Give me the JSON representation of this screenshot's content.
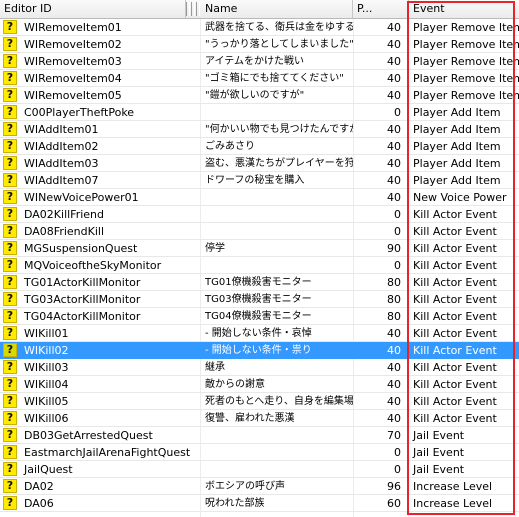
{
  "columns": {
    "editor_id": "Editor ID",
    "name": "Name",
    "priority": "P...",
    "event": "Event"
  },
  "rows": [
    {
      "icon": "?",
      "id": "WIRemoveItem01",
      "name": "武器を捨てる、衛兵は金をゆする",
      "p": "40",
      "event": "Player Remove Item"
    },
    {
      "icon": "?",
      "id": "WIRemoveItem02",
      "name": "\"うっかり落としてしまいました\"",
      "p": "40",
      "event": "Player Remove Item"
    },
    {
      "icon": "?",
      "id": "WIRemoveItem03",
      "name": "アイテムをかけた戦い",
      "p": "40",
      "event": "Player Remove Item"
    },
    {
      "icon": "?",
      "id": "WIRemoveItem04",
      "name": "\"ゴミ箱にでも捨ててください\"",
      "p": "40",
      "event": "Player Remove Item"
    },
    {
      "icon": "?",
      "id": "WIRemoveItem05",
      "name": "\"鎧が欲しいのですが\"",
      "p": "40",
      "event": "Player Remove Item"
    },
    {
      "icon": "?",
      "id": "C00PlayerTheftPoke",
      "name": "",
      "p": "0",
      "event": "Player Add Item"
    },
    {
      "icon": "?",
      "id": "WIAddItem01",
      "name": "\"何かいい物でも見つけたんですか？\"",
      "p": "40",
      "event": "Player Add Item"
    },
    {
      "icon": "?",
      "id": "WIAddItem02",
      "name": "ごみあさり",
      "p": "40",
      "event": "Player Add Item"
    },
    {
      "icon": "?",
      "id": "WIAddItem03",
      "name": "盗む、悪漢たちがプレイヤーを狩る",
      "p": "40",
      "event": "Player Add Item"
    },
    {
      "icon": "?",
      "id": "WIAddItem07",
      "name": "ドワーフの秘宝を購入",
      "p": "40",
      "event": "Player Add Item"
    },
    {
      "icon": "?",
      "id": "WINewVoicePower01",
      "name": "",
      "p": "40",
      "event": "New Voice Power"
    },
    {
      "icon": "?",
      "id": "DA02KillFriend",
      "name": "",
      "p": "0",
      "event": "Kill Actor Event"
    },
    {
      "icon": "?",
      "id": "DA08FriendKill",
      "name": "",
      "p": "0",
      "event": "Kill Actor Event"
    },
    {
      "icon": "?",
      "id": "MGSuspensionQuest",
      "name": "停学",
      "p": "90",
      "event": "Kill Actor Event"
    },
    {
      "icon": "?",
      "id": "MQVoiceoftheSkyMonitor",
      "name": "",
      "p": "0",
      "event": "Kill Actor Event"
    },
    {
      "icon": "?",
      "id": "TG01ActorKillMonitor",
      "name": "TG01僚機殺害モニター",
      "p": "80",
      "event": "Kill Actor Event"
    },
    {
      "icon": "?",
      "id": "TG03ActorKillMonitor",
      "name": "TG03僚機殺害モニター",
      "p": "80",
      "event": "Kill Actor Event"
    },
    {
      "icon": "?",
      "id": "TG04ActorKillMonitor",
      "name": "TG04僚機殺害モニター",
      "p": "80",
      "event": "Kill Actor Event"
    },
    {
      "icon": "?",
      "id": "WIKill01",
      "name": "- 開始しない条件・哀悼",
      "p": "40",
      "event": "Kill Actor Event"
    },
    {
      "icon": "?",
      "id": "WIKill02",
      "name": "- 開始しない条件・祟り",
      "p": "40",
      "event": "Kill Actor Event",
      "selected": true
    },
    {
      "icon": "?",
      "id": "WIKill03",
      "name": "継承",
      "p": "40",
      "event": "Kill Actor Event"
    },
    {
      "icon": "?",
      "id": "WIKill04",
      "name": "敵からの謝意",
      "p": "40",
      "event": "Kill Actor Event"
    },
    {
      "icon": "?",
      "id": "WIKill05",
      "name": "死者のもとへ走り、自身を編集場所に…",
      "p": "40",
      "event": "Kill Actor Event"
    },
    {
      "icon": "?",
      "id": "WIKill06",
      "name": "復讐、雇われた悪漢",
      "p": "40",
      "event": "Kill Actor Event"
    },
    {
      "icon": "?",
      "id": "DB03GetArrestedQuest",
      "name": "",
      "p": "70",
      "event": "Jail Event"
    },
    {
      "icon": "?",
      "id": "EastmarchJailArenaFightQuest",
      "name": "",
      "p": "0",
      "event": "Jail Event"
    },
    {
      "icon": "?",
      "id": "JailQuest",
      "name": "",
      "p": "0",
      "event": "Jail Event"
    },
    {
      "icon": "?",
      "id": "DA02",
      "name": "ボエシアの呼び声",
      "p": "96",
      "event": "Increase Level"
    },
    {
      "icon": "?",
      "id": "DA06",
      "name": "呪われた部族",
      "p": "60",
      "event": "Increase Level"
    }
  ],
  "colors": {
    "selection": "#3399ff",
    "highlight_box": "#e8232a",
    "quest_icon": "#ffea00"
  },
  "icon_name": "quest-icon"
}
